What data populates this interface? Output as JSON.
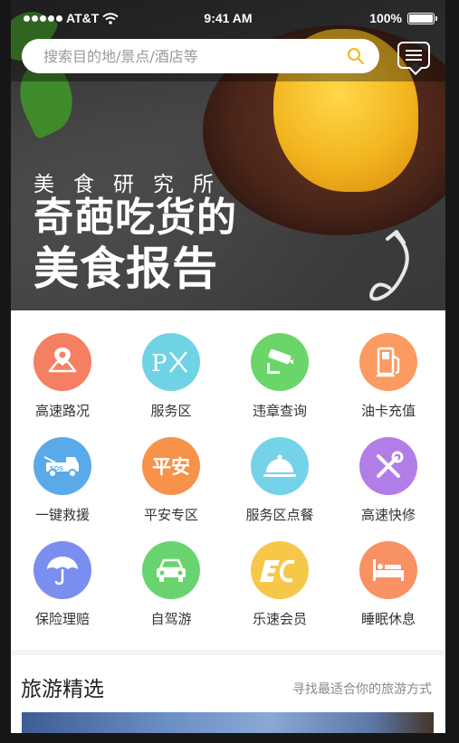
{
  "status_bar": {
    "carrier": "AT&T",
    "time": "9:41 AM",
    "battery": "100%",
    "battery_level": 1.0
  },
  "search": {
    "placeholder": "搜索目的地/景点/酒店等"
  },
  "banner": {
    "subtitle": "美食研究所",
    "title_line1": "奇葩吃货的",
    "title_line2": "美食报告"
  },
  "services": [
    {
      "label": "高速路况",
      "icon": "road-map-icon",
      "color": "#f57f62"
    },
    {
      "label": "服务区",
      "icon": "px-fork-knife-icon",
      "color": "#6fd3e3"
    },
    {
      "label": "违章查询",
      "icon": "camera-icon",
      "color": "#6bd56a"
    },
    {
      "label": "油卡充值",
      "icon": "fuel-pump-icon",
      "color": "#fb9a61"
    },
    {
      "label": "一键救援",
      "icon": "sos-truck-icon",
      "color": "#5aaaea"
    },
    {
      "label": "平安专区",
      "icon": "pingan-icon",
      "color": "#f7924a",
      "icon_text": "平安"
    },
    {
      "label": "服务区点餐",
      "icon": "food-cloche-icon",
      "color": "#74d3e8"
    },
    {
      "label": "高速快修",
      "icon": "wrench-screwdriver-icon",
      "color": "#b17ee8"
    },
    {
      "label": "保险理赔",
      "icon": "umbrella-icon",
      "color": "#7a8ef0"
    },
    {
      "label": "自驾游",
      "icon": "car-icon",
      "color": "#69d46f"
    },
    {
      "label": "乐速会员",
      "icon": "member-card-icon",
      "color": "#f6c84a"
    },
    {
      "label": "睡眠休息",
      "icon": "bed-icon",
      "color": "#f89163"
    }
  ],
  "travel": {
    "title": "旅游精选",
    "subtitle": "寻找最适合你的旅游方式"
  }
}
